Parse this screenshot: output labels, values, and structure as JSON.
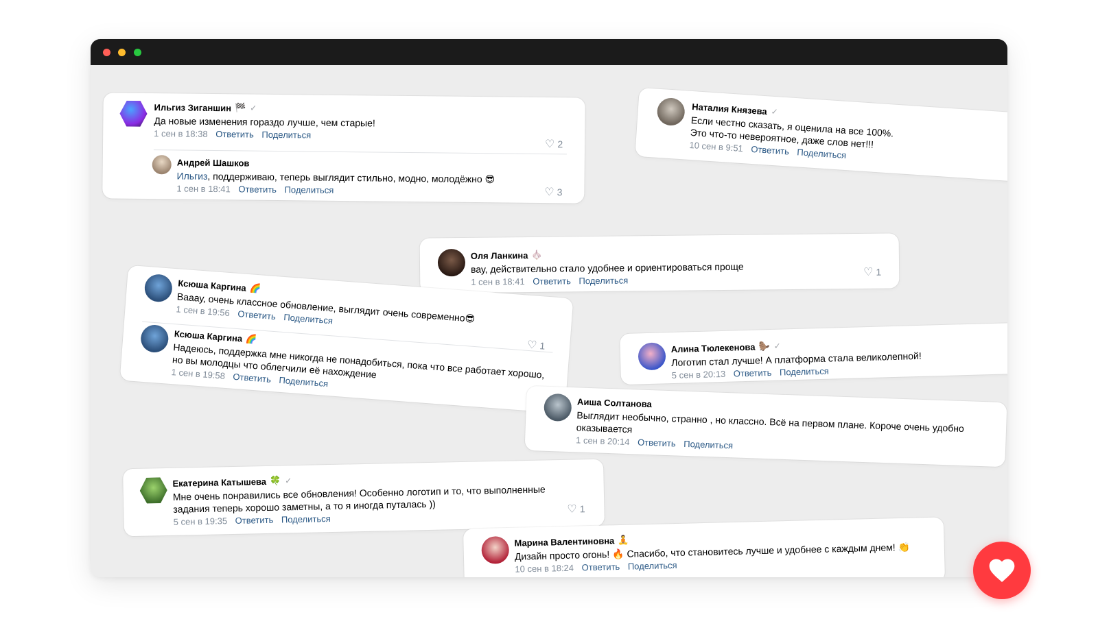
{
  "window": {
    "dots": [
      "close",
      "minimize",
      "maximize"
    ]
  },
  "comments": {
    "c1": {
      "name": "Ильгиз Зиганшин",
      "badge": "🏁",
      "text": "Да новые изменения гораздо лучше, чем старые!",
      "date": "1 сен в 18:38",
      "reply": "Ответить",
      "share": "Поделиться",
      "likes": "2"
    },
    "c1r": {
      "name": "Андрей Шашков",
      "mention": "Ильгиз",
      "text": ", поддерживаю, теперь выглядит стильно, модно, молодёжно 😎",
      "date": "1 сен в 18:41",
      "reply": "Ответить",
      "share": "Поделиться",
      "likes": "3"
    },
    "c2": {
      "name": "Наталия Князева",
      "text": "Если честно сказать, я оценила на все 100%. Это что-то невероятное, даже слов нет!!!",
      "date": "10 сен в 9:51",
      "reply": "Ответить",
      "share": "Поделиться"
    },
    "c3": {
      "name": "Оля Ланкина",
      "badge": "🧄",
      "text": "вау, действительно стало удобнее и ориентироваться проще",
      "date": "1 сен в 18:41",
      "reply": "Ответить",
      "share": "Поделиться",
      "likes": "1"
    },
    "c4": {
      "name": "Ксюша Каргина",
      "badge": "🌈",
      "text": "Вааау, очень классное обновление, выглядит очень современно😎",
      "date": "1 сен в 19:56",
      "reply": "Ответить",
      "share": "Поделиться",
      "likes": "1"
    },
    "c4b": {
      "name": "Ксюша Каргина",
      "badge": "🌈",
      "text": "Надеюсь, поддержка мне никогда не понадобиться, пока что все работает хорошо, но вы молодцы что облегчили её нахождение",
      "date": "1 сен в 19:58",
      "reply": "Ответить",
      "share": "Поделиться"
    },
    "c5": {
      "name": "Алина Тюлекенова",
      "badge": "🦫",
      "text": "Логотип стал лучше! А платформа стала великолепной!",
      "date": "5 сен в 20:13",
      "reply": "Ответить",
      "share": "Поделиться"
    },
    "c6": {
      "name": "Аиша Солтанова",
      "text": "Выглядит необычно, странно , но классно. Всё на первом плане. Короче очень удобно оказывается",
      "date": "1 сен в 20:14",
      "reply": "Ответить",
      "share": "Поделиться"
    },
    "c7": {
      "name": "Екатерина Катышева",
      "badge": "🍀",
      "text": "Мне очень понравились все обновления! Особенно логотип и то, что выполненные задания теперь хорошо заметны, а то я иногда путалась ))",
      "date": "5 сен в 19:35",
      "reply": "Ответить",
      "share": "Поделиться",
      "likes": "1"
    },
    "c8": {
      "name": "Марина Валентиновна",
      "badge": "🧘",
      "text": "Дизайн просто огонь! 🔥 Спасибо, что становитесь лучше и удобнее с каждым днем! 👏",
      "date": "10 сен в 18:24",
      "reply": "Ответить",
      "share": "Поделиться"
    }
  },
  "colors": {
    "accent": "#2a5885",
    "meta": "#818c99",
    "heart": "#ff3a3f",
    "titlebar": "#1b1b1b",
    "canvas": "#ededed"
  },
  "icons": {
    "like": "heart-outline-icon",
    "verified": "check-icon",
    "favorite": "heart-filled-icon"
  }
}
